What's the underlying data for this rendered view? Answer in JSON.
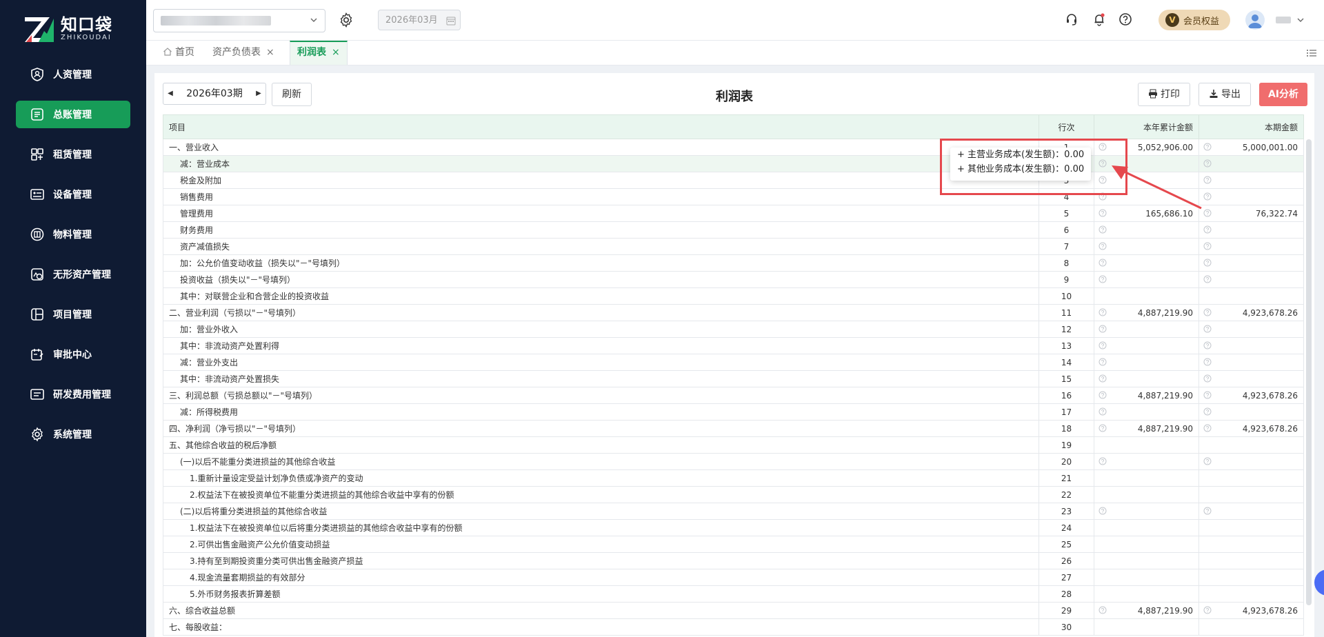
{
  "sidebar": {
    "logo_cn": "知口袋",
    "logo_en": "ZHIKOUDAI",
    "items": [
      {
        "label": "人资管理",
        "icon": "person-shield-icon",
        "active": false
      },
      {
        "label": "总账管理",
        "icon": "ledger-icon",
        "active": true
      },
      {
        "label": "租赁管理",
        "icon": "lease-icon",
        "active": false
      },
      {
        "label": "设备管理",
        "icon": "device-icon",
        "active": false
      },
      {
        "label": "物料管理",
        "icon": "material-icon",
        "active": false
      },
      {
        "label": "无形资产管理",
        "icon": "intangible-asset-icon",
        "active": false
      },
      {
        "label": "项目管理",
        "icon": "project-icon",
        "active": false
      },
      {
        "label": "审批中心",
        "icon": "approval-icon",
        "active": false
      },
      {
        "label": "研发费用管理",
        "icon": "rnd-expense-icon",
        "active": false
      },
      {
        "label": "系统管理",
        "icon": "settings-icon",
        "active": false
      }
    ]
  },
  "header": {
    "date_value": "2026年03月",
    "vip_badge": "V",
    "vip_label": "会员权益",
    "icons": [
      "headset-icon",
      "bell-icon",
      "help-icon"
    ]
  },
  "tabs": [
    {
      "label": "首页",
      "closable": false,
      "active": false
    },
    {
      "label": "资产负债表",
      "closable": true,
      "active": false
    },
    {
      "label": "利润表",
      "closable": true,
      "active": true
    }
  ],
  "toolbar": {
    "period": "2026年03期",
    "refresh": "刷新",
    "title": "利润表",
    "print": "打印",
    "export": "导出",
    "ai": "AI分析"
  },
  "table": {
    "headers": [
      "项目",
      "行次",
      "本年累计金额",
      "本期金额"
    ],
    "rows": [
      {
        "item": "一、营业收入",
        "no": "1",
        "ytd": "5,052,906.00",
        "cur": "5,000,001.00",
        "indent": 0,
        "q": true
      },
      {
        "item": "减：营业成本",
        "no": "2",
        "ytd": "",
        "cur": "",
        "indent": 1,
        "q": true,
        "hl": true
      },
      {
        "item": "税金及附加",
        "no": "3",
        "ytd": "",
        "cur": "",
        "indent": 1,
        "q": true
      },
      {
        "item": "销售费用",
        "no": "4",
        "ytd": "",
        "cur": "",
        "indent": 1,
        "q": true
      },
      {
        "item": "管理费用",
        "no": "5",
        "ytd": "165,686.10",
        "cur": "76,322.74",
        "indent": 1,
        "q": true
      },
      {
        "item": "财务费用",
        "no": "6",
        "ytd": "",
        "cur": "",
        "indent": 1,
        "q": true
      },
      {
        "item": "资产减值损失",
        "no": "7",
        "ytd": "",
        "cur": "",
        "indent": 1,
        "q": true
      },
      {
        "item": "加：公允价值变动收益（损失以\"－\"号填列）",
        "no": "8",
        "ytd": "",
        "cur": "",
        "indent": 1,
        "q": true
      },
      {
        "item": "投资收益（损失以\"－\"号填列）",
        "no": "9",
        "ytd": "",
        "cur": "",
        "indent": 1,
        "q": true
      },
      {
        "item": "其中：对联营企业和合营企业的投资收益",
        "no": "10",
        "ytd": "",
        "cur": "",
        "indent": 1,
        "q": false
      },
      {
        "item": "二、营业利润（亏损以\"－\"号填列）",
        "no": "11",
        "ytd": "4,887,219.90",
        "cur": "4,923,678.26",
        "indent": 0,
        "q": true
      },
      {
        "item": "加：营业外收入",
        "no": "12",
        "ytd": "",
        "cur": "",
        "indent": 1,
        "q": true
      },
      {
        "item": "其中：非流动资产处置利得",
        "no": "13",
        "ytd": "",
        "cur": "",
        "indent": 1,
        "q": true
      },
      {
        "item": "减：营业外支出",
        "no": "14",
        "ytd": "",
        "cur": "",
        "indent": 1,
        "q": true
      },
      {
        "item": "其中：非流动资产处置损失",
        "no": "15",
        "ytd": "",
        "cur": "",
        "indent": 1,
        "q": true
      },
      {
        "item": "三、利润总额（亏损总额以\"－\"号填列）",
        "no": "16",
        "ytd": "4,887,219.90",
        "cur": "4,923,678.26",
        "indent": 0,
        "q": true
      },
      {
        "item": "减：所得税费用",
        "no": "17",
        "ytd": "",
        "cur": "",
        "indent": 1,
        "q": true
      },
      {
        "item": "四、净利润（净亏损以\"－\"号填列）",
        "no": "18",
        "ytd": "4,887,219.90",
        "cur": "4,923,678.26",
        "indent": 0,
        "q": true
      },
      {
        "item": "五、其他综合收益的税后净额",
        "no": "19",
        "ytd": "",
        "cur": "",
        "indent": 0,
        "q": false
      },
      {
        "item": "(一)以后不能重分类进损益的其他综合收益",
        "no": "20",
        "ytd": "",
        "cur": "",
        "indent": 1,
        "q": true
      },
      {
        "item": "1.重新计量设定受益计划净负债或净资产的变动",
        "no": "21",
        "ytd": "",
        "cur": "",
        "indent": 2,
        "q": false
      },
      {
        "item": "2.权益法下在被投资单位不能重分类进损益的其他综合收益中享有的份额",
        "no": "22",
        "ytd": "",
        "cur": "",
        "indent": 2,
        "q": false
      },
      {
        "item": "(二)以后将重分类进损益的其他综合收益",
        "no": "23",
        "ytd": "",
        "cur": "",
        "indent": 1,
        "q": true
      },
      {
        "item": "1.权益法下在被投资单位以后将重分类进损益的其他综合收益中享有的份额",
        "no": "24",
        "ytd": "",
        "cur": "",
        "indent": 2,
        "q": false
      },
      {
        "item": "2.可供出售金融资产公允价值变动损益",
        "no": "25",
        "ytd": "",
        "cur": "",
        "indent": 2,
        "q": false
      },
      {
        "item": "3.持有至到期投资重分类可供出售金融资产损益",
        "no": "26",
        "ytd": "",
        "cur": "",
        "indent": 2,
        "q": false
      },
      {
        "item": "4.现金流量套期损益的有效部分",
        "no": "27",
        "ytd": "",
        "cur": "",
        "indent": 2,
        "q": false
      },
      {
        "item": "5.外币财务报表折算差额",
        "no": "28",
        "ytd": "",
        "cur": "",
        "indent": 2,
        "q": false
      },
      {
        "item": "六、综合收益总额",
        "no": "29",
        "ytd": "4,887,219.90",
        "cur": "4,923,678.26",
        "indent": 0,
        "q": true
      },
      {
        "item": "七、每股收益：",
        "no": "30",
        "ytd": "",
        "cur": "",
        "indent": 0,
        "q": false
      }
    ]
  },
  "tooltip": {
    "lines": [
      "+ 主营业务成本(发生额)：0.00",
      "+ 其他业务成本(发生额)：0.00"
    ]
  },
  "colors": {
    "sidebar_bg": "#0f1b33",
    "accent_green": "#179c58",
    "ai_button": "#f06d6d",
    "highlight_red": "#e5484d"
  }
}
